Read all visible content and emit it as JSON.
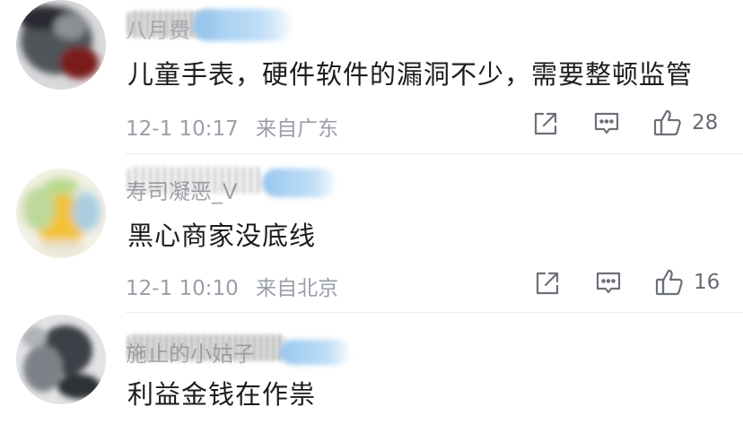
{
  "comments": [
    {
      "username": "八月费",
      "text": "儿童手表，硬件软件的漏洞不少，需要整顿监管",
      "time": "12-1 10:17",
      "location": "来自广东",
      "likes": "28"
    },
    {
      "username": "寿司凝恶_V",
      "text": "黑心商家没底线",
      "time": "12-1 10:10",
      "location": "来自北京",
      "likes": "16"
    },
    {
      "username": "施止的小姑子",
      "text": "利益金钱在作祟",
      "time": "",
      "location": "",
      "likes": ""
    }
  ],
  "icons": {
    "share": "share-icon",
    "reply": "comment-icon",
    "like": "thumbs-up-icon"
  },
  "colors": {
    "text": "#1c1c1e",
    "meta": "#9a9fa7",
    "icon": "#6b7079",
    "divider": "#ececec"
  }
}
